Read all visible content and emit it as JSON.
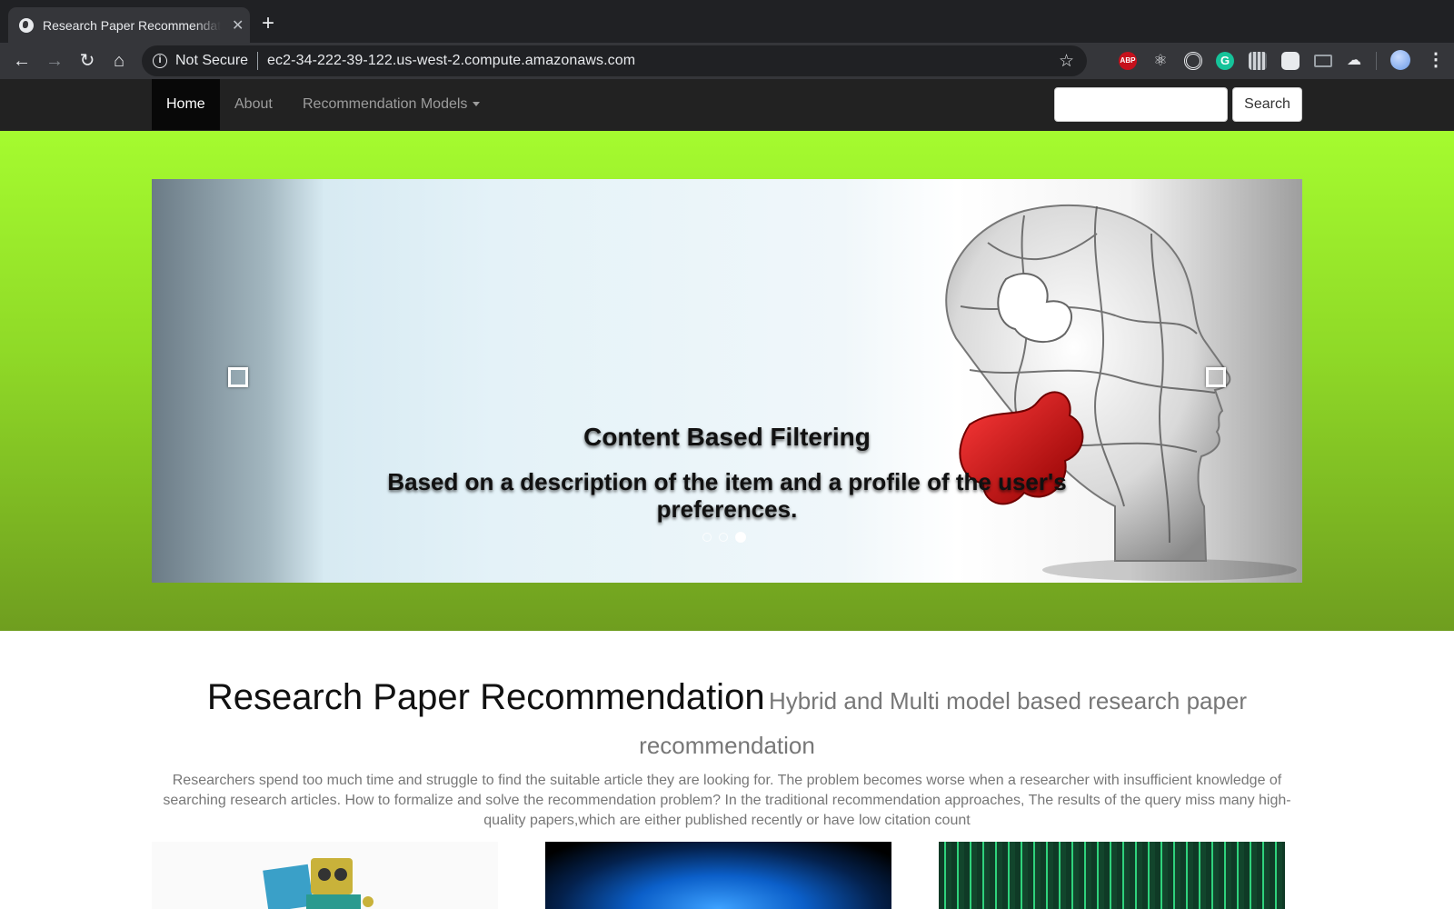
{
  "browser": {
    "tab_title": "Research Paper Recommendat",
    "tab_close": "✕",
    "new_tab": "+",
    "security_label": "Not Secure",
    "url": "ec2-34-222-39-122.us-west-2.compute.amazonaws.com",
    "extensions": [
      "abp-icon",
      "react-devtools-icon",
      "target-icon",
      "grammarly-icon",
      "qr-code-icon",
      "notes-icon",
      "mail-icon",
      "cloud-icon"
    ],
    "abp_label": "ABP"
  },
  "navbar": {
    "items": [
      "Home",
      "About",
      "Recommendation Models"
    ],
    "search_button": "Search",
    "search_placeholder": ""
  },
  "carousel": {
    "caption_title": "Content Based Filtering",
    "caption_text": "Based on a description of the item and a profile of the user's preferences.",
    "slide_count": 3,
    "active_slide": 3
  },
  "content": {
    "title": "Research Paper Recommendation",
    "subtitle": "Hybrid and Multi model based research paper recommendation",
    "lead": "Researchers spend too much time and struggle to find the suitable article they are looking for. The problem becomes worse when a researcher with insufficient knowledge of searching research articles. How to formalize and solve the recommendation problem? In the traditional recommendation approaches, The results of the query miss many high-quality papers,which are either published recently or have low citation count"
  },
  "colors": {
    "hero_top": "#a5fb2f",
    "hero_bottom": "#6f9e1f",
    "navbar_bg": "#222222",
    "puzzle_red": "#d51212"
  }
}
